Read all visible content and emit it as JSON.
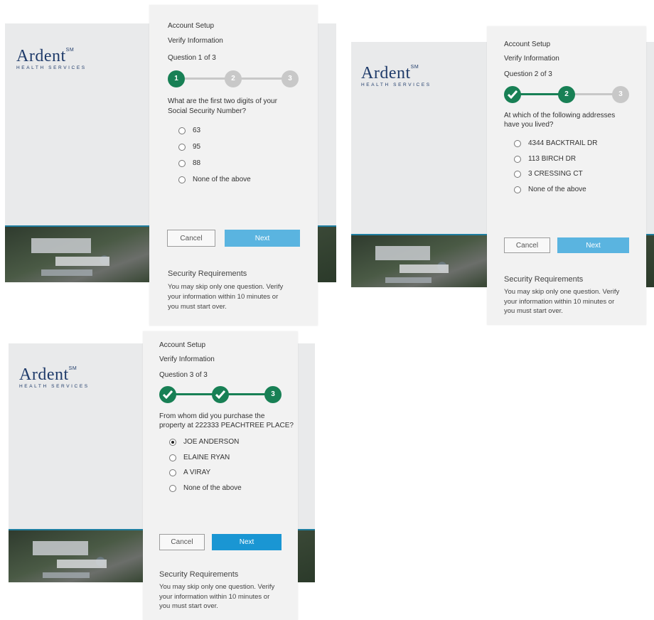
{
  "brand": {
    "name": "Ardent",
    "mark": "SM",
    "tagline": "HEALTH SERVICES"
  },
  "common": {
    "account_setup": "Account Setup",
    "verify_information": "Verify Information",
    "cancel_label": "Cancel",
    "next_label": "Next",
    "security_heading": "Security Requirements",
    "security_text_lines": [
      "You may skip only one question. Verify",
      "your information within 10 minutes or",
      "you must start over."
    ]
  },
  "screens": [
    {
      "question_counter": "Question 1 of 3",
      "steps": [
        "1",
        "2",
        "3"
      ],
      "question_lines": [
        "What are the first two digits of your",
        "Social Security Number?"
      ],
      "options": [
        {
          "label": "63",
          "selected": false
        },
        {
          "label": "95",
          "selected": false
        },
        {
          "label": "88",
          "selected": false
        },
        {
          "label": "None of the above",
          "selected": false
        }
      ]
    },
    {
      "question_counter": "Question 2 of 3",
      "steps": [
        "check",
        "2",
        "3"
      ],
      "question_lines": [
        "At which of the following addresses",
        "have you lived?"
      ],
      "options": [
        {
          "label": "4344 BACKTRAIL DR",
          "selected": false
        },
        {
          "label": "113 BIRCH DR",
          "selected": false
        },
        {
          "label": "3 CRESSING CT",
          "selected": false
        },
        {
          "label": "None of the above",
          "selected": false
        }
      ]
    },
    {
      "question_counter": "Question 3 of 3",
      "steps": [
        "check",
        "check",
        "3"
      ],
      "question_lines": [
        "From whom did you purchase the",
        "property at 222333 PEACHTREE PLACE?"
      ],
      "options": [
        {
          "label": "JOE ANDERSON",
          "selected": true
        },
        {
          "label": "ELAINE RYAN",
          "selected": false
        },
        {
          "label": "A VIRAY",
          "selected": false
        },
        {
          "label": "None of the above",
          "selected": false
        }
      ]
    }
  ],
  "colors": {
    "accent_green": "#188055",
    "step_inactive": "#c8c8c8",
    "next_light": "#5ab4e0",
    "next_dark": "#1a96d3",
    "brand_navy": "#1f3b6a"
  }
}
